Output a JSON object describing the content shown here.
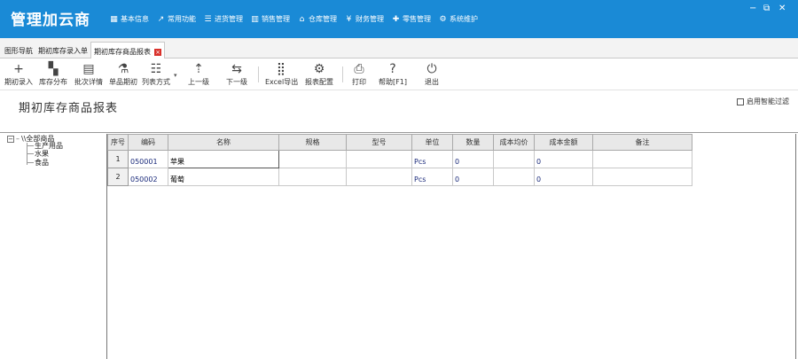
{
  "app": {
    "logo": "管理加云商",
    "nav": [
      {
        "label": "基本信息",
        "icon": "grid-icon"
      },
      {
        "label": "常用功能",
        "icon": "external-link-icon"
      },
      {
        "label": "进货管理",
        "icon": "list-icon"
      },
      {
        "label": "销售管理",
        "icon": "bar-chart-icon"
      },
      {
        "label": "仓库管理",
        "icon": "home-icon"
      },
      {
        "label": "财务管理",
        "icon": "yen-icon"
      },
      {
        "label": "零售管理",
        "icon": "plus-arrow-icon"
      },
      {
        "label": "系统维护",
        "icon": "settings-circle-icon"
      }
    ],
    "window_controls": [
      "−",
      "⧉",
      "✕"
    ]
  },
  "tabs": [
    {
      "label": "图形导航",
      "active": false
    },
    {
      "label": "期初库存录入单",
      "active": false
    },
    {
      "label": "期初库存商品报表",
      "active": true,
      "close": "×"
    }
  ],
  "toolbar": [
    {
      "label": "期初录入",
      "icon": "plus-icon"
    },
    {
      "label": "库存分布",
      "icon": "boxes-icon"
    },
    {
      "label": "批次详情",
      "icon": "document-icon"
    },
    {
      "label": "单品期初",
      "icon": "flask-icon"
    },
    {
      "label": "列表方式",
      "icon": "list-view-icon",
      "caret": "▾"
    },
    {
      "label": "上一级",
      "icon": "level-up-icon"
    },
    {
      "label": "下一级",
      "icon": "level-down-icon"
    },
    {
      "label": "Excel导出",
      "icon": "excel-grid-icon"
    },
    {
      "label": "报表配置",
      "icon": "gear-icon"
    },
    {
      "label": "打印",
      "icon": "printer-icon"
    },
    {
      "label": "帮助[F1]",
      "icon": "question-icon"
    },
    {
      "label": "退出",
      "icon": "power-icon"
    }
  ],
  "report": {
    "title": "期初库存商品报表",
    "smart_filter_label": "启用智能过滤",
    "smart_filter_checked": false
  },
  "tree": {
    "root": {
      "toggle": "⊟",
      "label": "\\\\全部商品"
    },
    "children": [
      "生产用品",
      "水果",
      "食品"
    ]
  },
  "grid": {
    "columns": [
      "序号",
      "编码",
      "名称",
      "规格",
      "型号",
      "单位",
      "数量",
      "成本均价",
      "成本金额",
      "备注"
    ],
    "rows": [
      {
        "no": "1",
        "code": "050001",
        "name": "苹果",
        "spec": "",
        "model": "",
        "unit": "Pcs",
        "qty": "0",
        "avg_cost": "",
        "amount": "0",
        "remark": ""
      },
      {
        "no": "2",
        "code": "050002",
        "name": "葡萄",
        "spec": "",
        "model": "",
        "unit": "Pcs",
        "qty": "0",
        "avg_cost": "",
        "amount": "0",
        "remark": ""
      }
    ]
  }
}
